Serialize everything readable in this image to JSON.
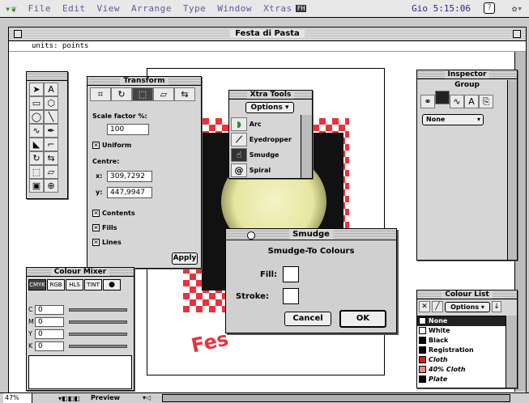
{
  "menubar": {
    "items": [
      "File",
      "Edit",
      "View",
      "Arrange",
      "Type",
      "Window",
      "Xtras"
    ],
    "clock": "Gio 5:15:06"
  },
  "document": {
    "title": "Festa di Pasta",
    "units": "units: points",
    "canvas_text": "Fes"
  },
  "transform": {
    "title": "Transform",
    "scale_label": "Scale factor %:",
    "scale_value": "100",
    "uniform": "Uniform",
    "centre_label": "Centre:",
    "x_label": "x:",
    "x_value": "309,7292",
    "y_label": "y:",
    "y_value": "447,9947",
    "contents": "Contents",
    "fills": "Fills",
    "lines": "Lines",
    "apply": "Apply"
  },
  "xtra": {
    "title": "Xtra Tools",
    "options": "Options",
    "items": [
      "Arc",
      "Eyedropper",
      "Smudge",
      "Spiral"
    ]
  },
  "inspector": {
    "title": "Inspector",
    "group": "Group",
    "none": "None"
  },
  "smudge": {
    "title": "Smudge",
    "heading": "Smudge-To Colours",
    "fill": "Fill:",
    "stroke": "Stroke:",
    "cancel": "Cancel",
    "ok": "OK"
  },
  "mixer": {
    "title": "Colour Mixer",
    "tabs": [
      "CMYK",
      "RGB",
      "HLS",
      "TINT"
    ],
    "rows": [
      {
        "label": "C",
        "value": "0"
      },
      {
        "label": "M",
        "value": "0"
      },
      {
        "label": "Y",
        "value": "0"
      },
      {
        "label": "K",
        "value": "0"
      }
    ]
  },
  "colourlist": {
    "title": "Colour List",
    "options": "Options",
    "items": [
      {
        "name": "None",
        "color": "#ffffff"
      },
      {
        "name": "White",
        "color": "#ffffff"
      },
      {
        "name": "Black",
        "color": "#000000"
      },
      {
        "name": "Registration",
        "color": "#000000"
      },
      {
        "name": "Cloth",
        "color": "#cc2222"
      },
      {
        "name": "40% Cloth",
        "color": "#e08a8a"
      },
      {
        "name": "Plate",
        "color": "#000000"
      }
    ]
  },
  "status": {
    "zoom": "47%",
    "view": "Preview"
  },
  "colors": {
    "accent": "#e8323c",
    "pasta": "#eeeebb"
  }
}
